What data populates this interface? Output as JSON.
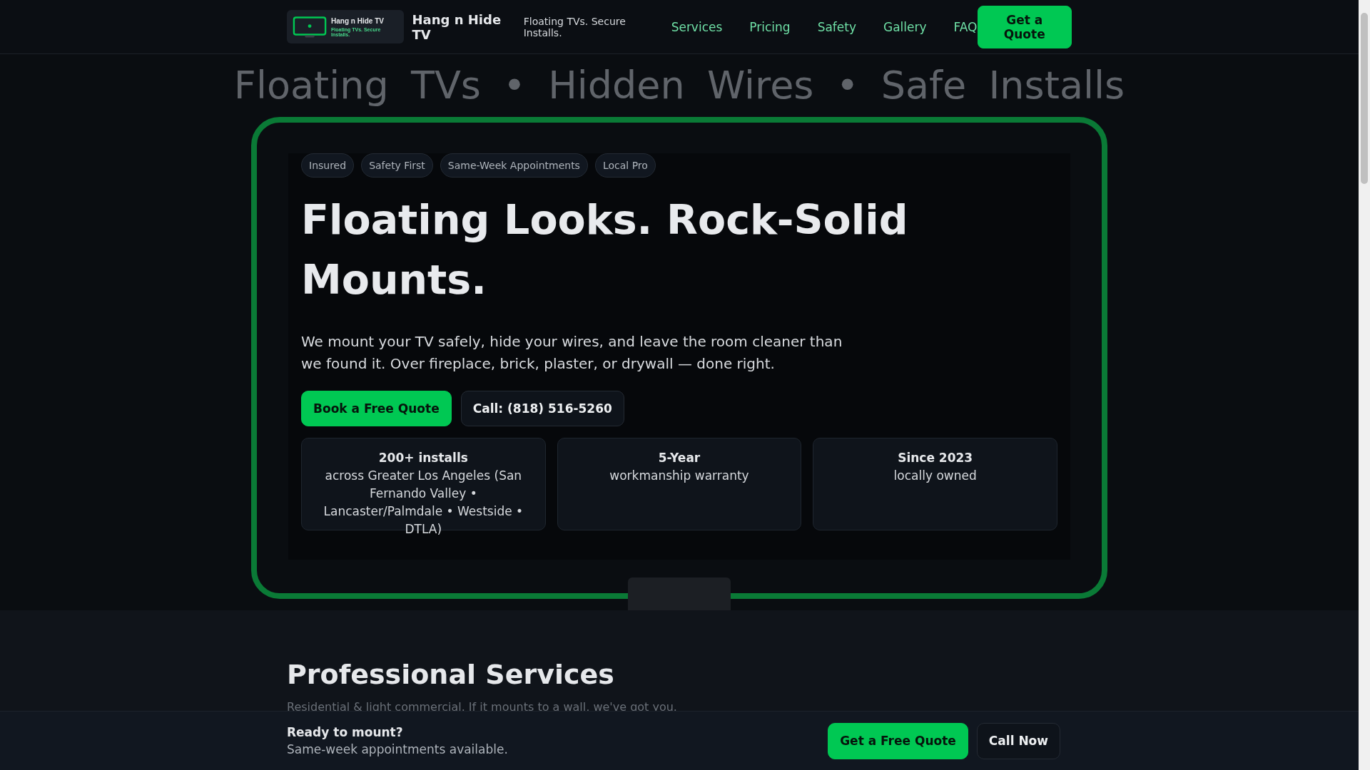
{
  "header": {
    "logo": {
      "title": "Hang n Hide TV",
      "tagline": "Floating TVs. Secure Installs."
    },
    "brand": "Hang n Hide TV",
    "tagline": "Floating TVs. Secure Installs.",
    "nav": [
      {
        "label": "Services"
      },
      {
        "label": "Pricing"
      },
      {
        "label": "Safety"
      },
      {
        "label": "Gallery"
      },
      {
        "label": "FAQ"
      }
    ],
    "cta": "Get a Quote"
  },
  "marquee": "Floating TVs • Hidden Wires • Safe Installs",
  "hero": {
    "chips": [
      "Insured",
      "Safety First",
      "Same-Week Appointments",
      "Local Pro"
    ],
    "headline": "Floating Looks. Rock-Solid Mounts.",
    "text": "We mount your TV safely, hide your wires, and leave the room cleaner than we found it. Over fireplace, brick, plaster, or drywall — done right.",
    "buttons": [
      {
        "label": "Book a Free Quote",
        "kind": "primary"
      },
      {
        "label": "Call: (818) 516-5260",
        "kind": "secondary"
      }
    ],
    "stats": [
      {
        "value": "200+ installs",
        "caption": "across Greater Los Angeles (San Fernando Valley • Lancaster/Palmdale • Westside • DTLA)"
      },
      {
        "value": "5-Year",
        "caption": "workmanship warranty"
      },
      {
        "value": "Since 2023",
        "caption": "locally owned"
      }
    ]
  },
  "services": {
    "title": "Professional Services",
    "subtitle": "Residential & light commercial. If it mounts to a wall, we've got you."
  },
  "sticky_bar": {
    "title": "Ready to mount?",
    "text": "Same-week appointments available.",
    "buttons": [
      {
        "label": "Get a Free Quote",
        "kind": "primary"
      },
      {
        "label": "Call Now",
        "kind": "secondary"
      }
    ]
  }
}
